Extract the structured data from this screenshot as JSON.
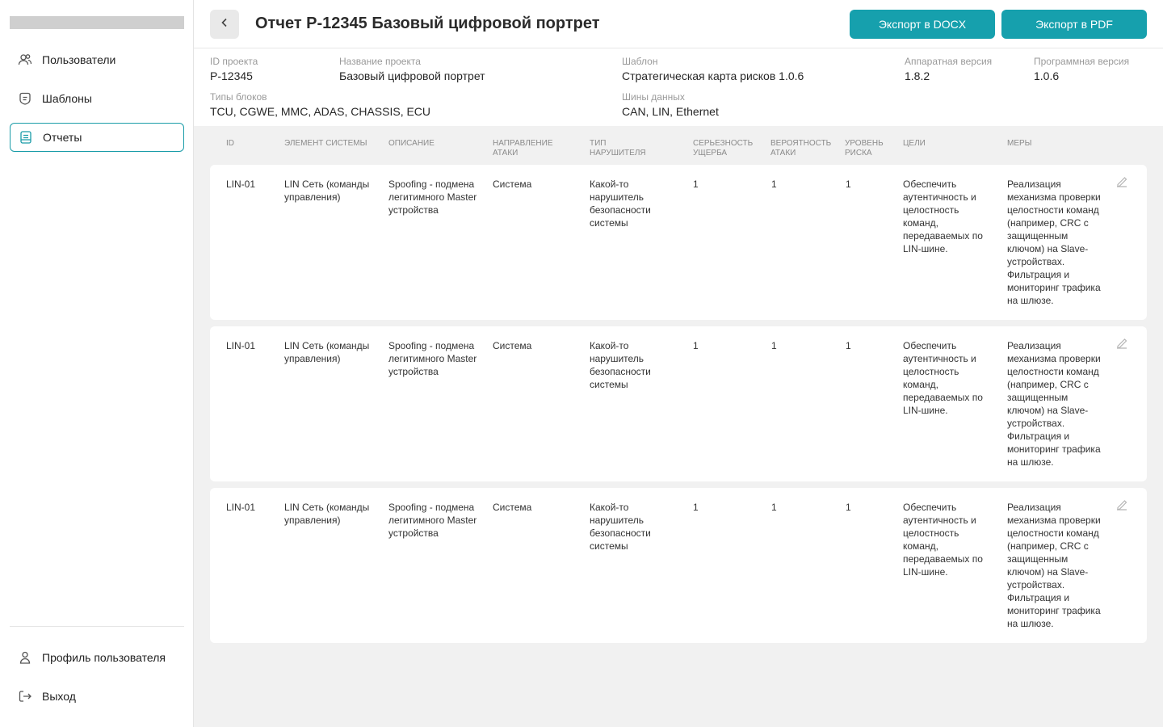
{
  "sidebar": {
    "items": [
      {
        "label": "Пользователи",
        "icon": "users-icon"
      },
      {
        "label": "Шаблоны",
        "icon": "templates-icon"
      },
      {
        "label": "Отчеты",
        "icon": "reports-icon",
        "active": true
      }
    ],
    "bottom": [
      {
        "label": "Профиль пользователя",
        "icon": "user-icon"
      },
      {
        "label": "Выход",
        "icon": "logout-icon"
      }
    ]
  },
  "header": {
    "title": "Отчет P-12345 Базовый цифровой портрет",
    "export_docx": "Экспорт в DOCX",
    "export_pdf": "Экспорт в PDF"
  },
  "info": {
    "project_id_label": "ID проекта",
    "project_id": "P-12345",
    "project_name_label": "Название проекта",
    "project_name": "Базовый цифровой портрет",
    "template_label": "Шаблон",
    "template": "Стратегическая карта рисков 1.0.6",
    "hw_label": "Аппаратная версия",
    "hw": "1.8.2",
    "sw_label": "Программная версия",
    "sw": "1.0.6",
    "block_types_label": "Типы блоков",
    "block_types": "TCU, CGWE, MMC, ADAS, CHASSIS, ECU",
    "buses_label": "Шины данных",
    "buses": "CAN, LIN, Ethernet"
  },
  "table": {
    "headers": [
      "ID",
      "Элемент системы",
      "Описание",
      "Направление атаки",
      "Тип нарушителя",
      "Серьезность ущерба",
      "Вероятность атаки",
      "Уровень риска",
      "Цели",
      "Меры"
    ],
    "rows": [
      {
        "id": "LIN-01",
        "element": "LIN Сеть (команды управления)",
        "description": "Spoofing - подмена легитимного Master устройства",
        "direction": "Система",
        "violator": "Какой-то нарушитель безопасности системы",
        "severity": "1",
        "probability": "1",
        "risk": "1",
        "goals": "Обеспечить аутентичность и целостность команд, передаваемых по LIN-шине.",
        "measures": "Реализация механизма проверки целостности команд (например, CRC с защищенным ключом) на Slave-устройствах. Фильтрация и мониторинг трафика на шлюзе."
      },
      {
        "id": "LIN-01",
        "element": "LIN Сеть (команды управления)",
        "description": "Spoofing - подмена легитимного Master устройства",
        "direction": "Система",
        "violator": "Какой-то нарушитель безопасности системы",
        "severity": "1",
        "probability": "1",
        "risk": "1",
        "goals": "Обеспечить аутентичность и целостность команд, передаваемых по LIN-шине.",
        "measures": "Реализация механизма проверки целостности команд (например, CRC с защищенным ключом) на Slave-устройствах. Фильтрация и мониторинг трафика на шлюзе."
      },
      {
        "id": "LIN-01",
        "element": "LIN Сеть (команды управления)",
        "description": "Spoofing - подмена легитимного Master устройства",
        "direction": "Система",
        "violator": "Какой-то нарушитель безопасности системы",
        "severity": "1",
        "probability": "1",
        "risk": "1",
        "goals": "Обеспечить аутентичность и целостность команд, передаваемых по LIN-шине.",
        "measures": "Реализация механизма проверки целостности команд (например, CRC с защищенным ключом) на Slave-устройствах. Фильтрация и мониторинг трафика на шлюзе."
      }
    ]
  },
  "colors": {
    "accent": "#16a0ad",
    "active_border": "#1a9ca8"
  }
}
